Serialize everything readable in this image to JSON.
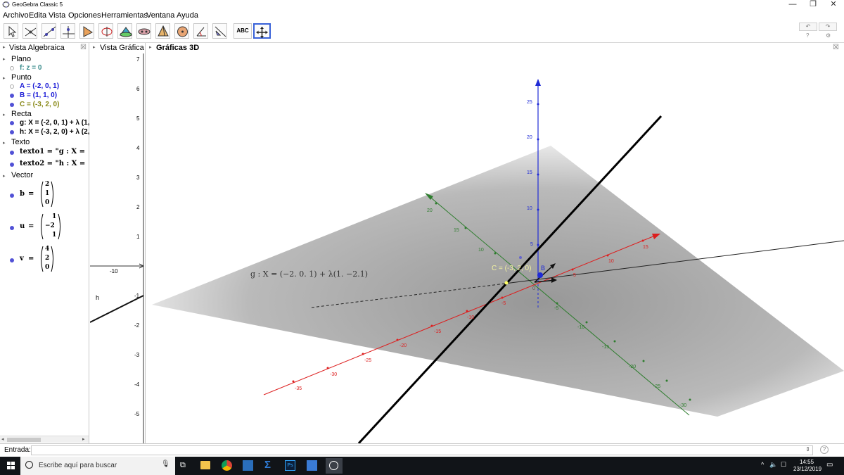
{
  "window": {
    "title": "GeoGebra Classic 5",
    "minimize": "—",
    "restore": "❐",
    "close": "✕"
  },
  "menu": [
    "Archivo",
    "Edita",
    "Vista",
    "Opciones",
    "Herramientas",
    "Ventana",
    "Ayuda"
  ],
  "toolbar": {
    "text_tool": "ABC",
    "undo": "↶",
    "redo": "↷",
    "help": "?",
    "settings": "⚙"
  },
  "panels": {
    "algebra": "Vista Algebraica",
    "graphics": "Vista Gráfica",
    "graphics3d": "Gráficas 3D",
    "close": "☒"
  },
  "algebra": {
    "plano": {
      "label": "Plano",
      "f": "f: z = 0"
    },
    "punto": {
      "label": "Punto",
      "A": "A = (-2, 0, 1)",
      "B": "B = (1, 1, 0)",
      "C": "C = (-3, 2, 0)"
    },
    "recta": {
      "label": "Recta",
      "g": "g: X = (-2, 0, 1) + λ (1,",
      "h": "h: X = (-3, 2, 0) + λ (2,"
    },
    "texto": {
      "label": "Texto",
      "t1": "texto1 = \"g : X =",
      "t2": "texto2 = \"h : X ="
    },
    "vector": {
      "label": "Vector",
      "b_name": "b",
      "u_name": "u",
      "v_name": "v",
      "b": [
        "2",
        "1",
        "0"
      ],
      "u": [
        "1",
        "−2",
        "1"
      ],
      "v": [
        "4",
        "2",
        "0"
      ]
    }
  },
  "view2d": {
    "yticks": [
      "7",
      "6",
      "5",
      "4",
      "3",
      "2",
      "1",
      "-1",
      "-2",
      "-3",
      "-4",
      "-5"
    ],
    "xtick": "-10",
    "h_label": "h"
  },
  "view3d": {
    "label_g": "g : X = (−2. 0. 1) + λ(1. −2.1)",
    "label_c": "C = (-3, 2, 0)",
    "label_b": "B",
    "z_ticks": [
      "25",
      "20",
      "15",
      "10",
      "5"
    ],
    "x_ticks": [
      "15",
      "10",
      "5",
      "-5",
      "-10",
      "-15",
      "-20",
      "-25",
      "-30",
      "-35"
    ],
    "y_ticks": [
      "20",
      "15",
      "10",
      "-5",
      "-10",
      "-15",
      "-20",
      "-25",
      "-30"
    ],
    "origin": "0",
    "colors": {
      "x_axis": "#dd1e1e",
      "y_axis": "#2e7d2e",
      "z_axis": "#1f2bd6"
    }
  },
  "input": {
    "label": "Entrada:",
    "value": ""
  },
  "taskbar": {
    "search_placeholder": "Escribe aquí para buscar",
    "time": "14:55",
    "date": "23/12/2019"
  }
}
